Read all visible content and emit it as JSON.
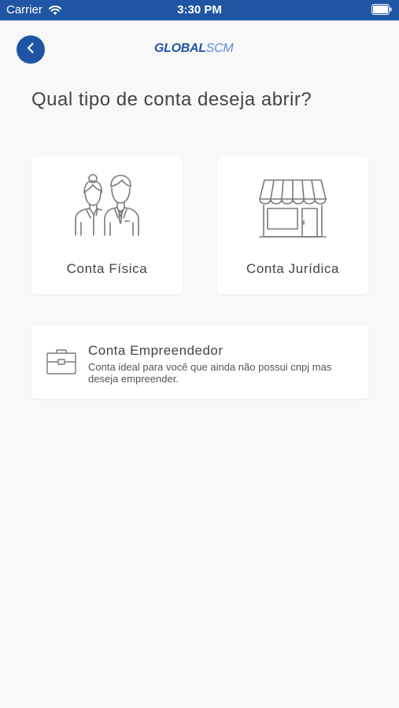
{
  "status_bar": {
    "carrier": "Carrier",
    "time": "3:30 PM",
    "background_color": "#1f55a3"
  },
  "header": {
    "back_icon": "chevron-left-icon",
    "logo_part1": "GLOBAL",
    "logo_part2": "SCM"
  },
  "page": {
    "title": "Qual tipo de conta deseja abrir?"
  },
  "options": [
    {
      "label": "Conta Física",
      "icon": "people-icon"
    },
    {
      "label": "Conta Jurídica",
      "icon": "storefront-icon"
    }
  ],
  "empreendedor": {
    "title": "Conta Empreendedor",
    "description": "Conta ideal para você que ainda não possui cnpj mas deseja empreender.",
    "icon": "briefcase-icon"
  },
  "colors": {
    "brand_blue": "#1f55a3",
    "logo_light_blue": "#5a8fd0",
    "background": "#f8f8f8",
    "text": "#444444"
  }
}
